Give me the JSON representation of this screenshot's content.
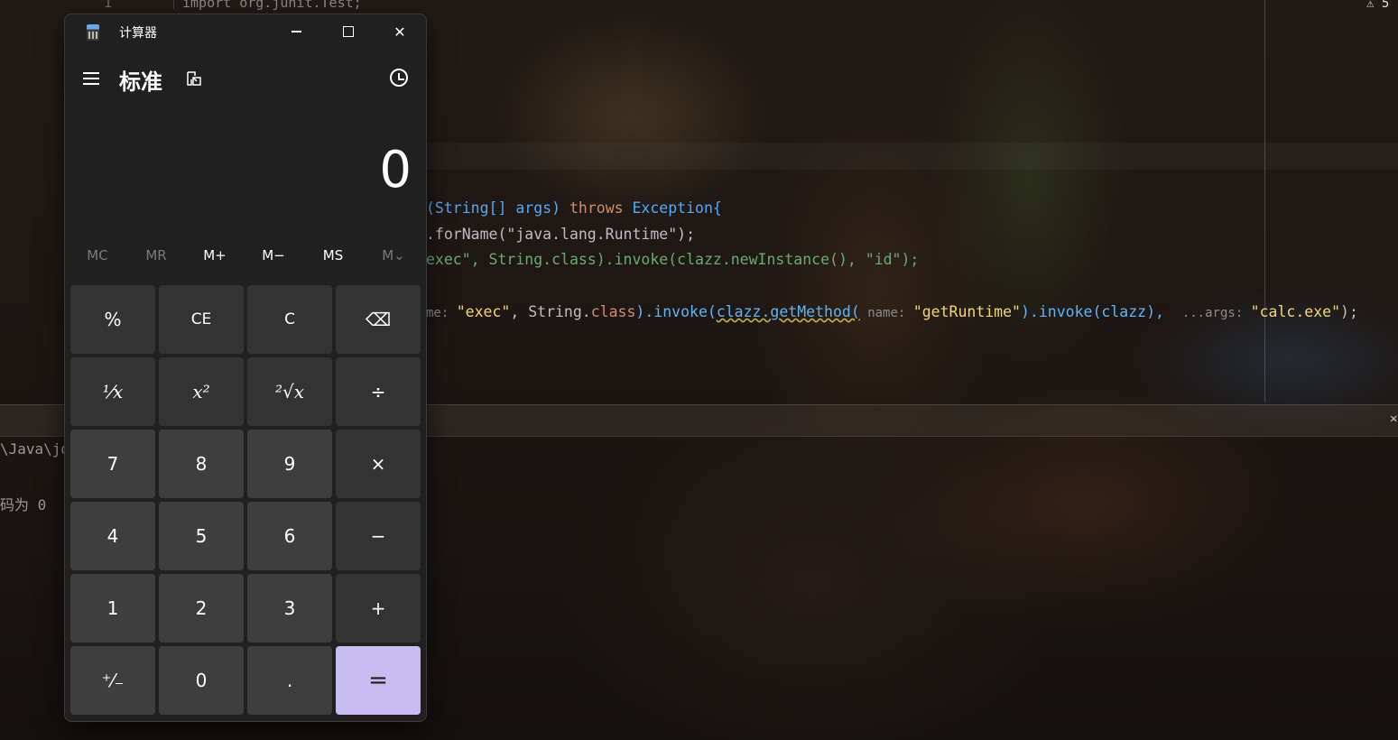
{
  "ide": {
    "line_number": "1",
    "import_line": "import org.junit.Test;",
    "code_line1": {
      "a": "(String[] args) ",
      "b": "throws ",
      "c": "Exception{"
    },
    "code_line2": {
      "a": ".forName(",
      "b": "\"java.lang.Runtime\"",
      "c": ");"
    },
    "code_line3": {
      "a": "exec\", String.class).invoke(clazz.newInstance(), \"id\");"
    },
    "code_line4": {
      "hint1": "me: ",
      "s1": "\"exec\"",
      "p1": ", String.",
      "k1": "class",
      "p2": ").invoke(",
      "squig": "clazz.getMethod(",
      "hint2": " name: ",
      "s2": "\"getRuntime\"",
      "p3": ").invoke(clazz),  ",
      "hint3": "...args: ",
      "s3": "\"calc.exe\"",
      "p4": ");"
    },
    "terminal_line1": "\\Java\\jd",
    "terminal_line2": "码为 0",
    "warning": "⚠ 5"
  },
  "calculator": {
    "title": "计算器",
    "mode": "标准",
    "display": "0",
    "memory": [
      "MC",
      "MR",
      "M+",
      "M−",
      "MS",
      "M⌄"
    ],
    "keys": {
      "percent": "%",
      "ce": "CE",
      "c": "C",
      "backspace": "⌫",
      "reciprocal": "¹⁄x",
      "square": "x²",
      "sqrt": "²√x",
      "divide": "÷",
      "seven": "7",
      "eight": "8",
      "nine": "9",
      "multiply": "×",
      "four": "4",
      "five": "5",
      "six": "6",
      "minus": "−",
      "one": "1",
      "two": "2",
      "three": "3",
      "plus": "+",
      "negate": "⁺⁄₋",
      "zero": "0",
      "decimal": ".",
      "equals": "="
    }
  }
}
